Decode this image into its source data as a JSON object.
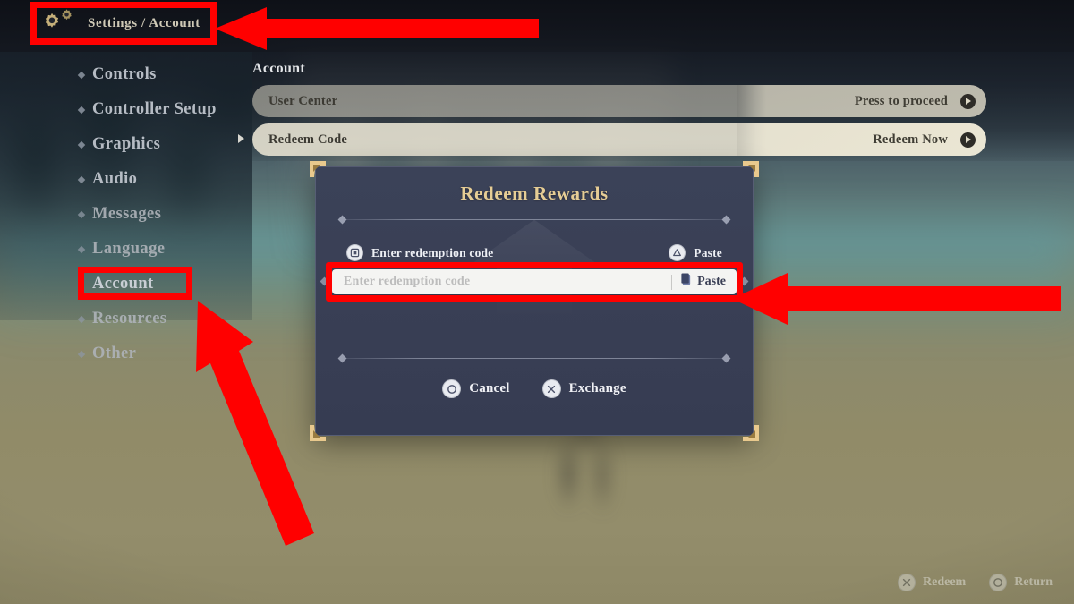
{
  "header": {
    "title": "Settings / Account",
    "gear_icon": "gear-icon"
  },
  "sidebar": {
    "items": [
      {
        "label": "Controls"
      },
      {
        "label": "Controller Setup"
      },
      {
        "label": "Graphics"
      },
      {
        "label": "Audio"
      },
      {
        "label": "Messages"
      },
      {
        "label": "Language"
      },
      {
        "label": "Account"
      },
      {
        "label": "Resources"
      },
      {
        "label": "Other"
      }
    ],
    "active_index": 6
  },
  "content": {
    "section_title": "Account",
    "rows": [
      {
        "label": "User Center",
        "value": "Press to proceed"
      },
      {
        "label": "Redeem Code",
        "value": "Redeem Now"
      }
    ],
    "selected_row_index": 1
  },
  "modal": {
    "title": "Redeem Rewards",
    "hint_enter": {
      "button": "square",
      "label": "Enter redemption code"
    },
    "hint_paste": {
      "button": "triangle",
      "label": "Paste"
    },
    "input": {
      "placeholder": "Enter redemption code",
      "value": ""
    },
    "paste_button": {
      "label": "Paste",
      "icon": "clipboard-icon"
    },
    "cancel_button": {
      "button": "circle",
      "label": "Cancel"
    },
    "exchange_button": {
      "button": "cross",
      "label": "Exchange"
    }
  },
  "bottom_hints": [
    {
      "button": "cross",
      "label": "Redeem"
    },
    {
      "button": "circle",
      "label": "Return"
    }
  ],
  "colors": {
    "gold": "#e6cd95",
    "modal_bg": "#393f55",
    "annotation_red": "#ff0000",
    "row_cream": "#ded9c6"
  }
}
